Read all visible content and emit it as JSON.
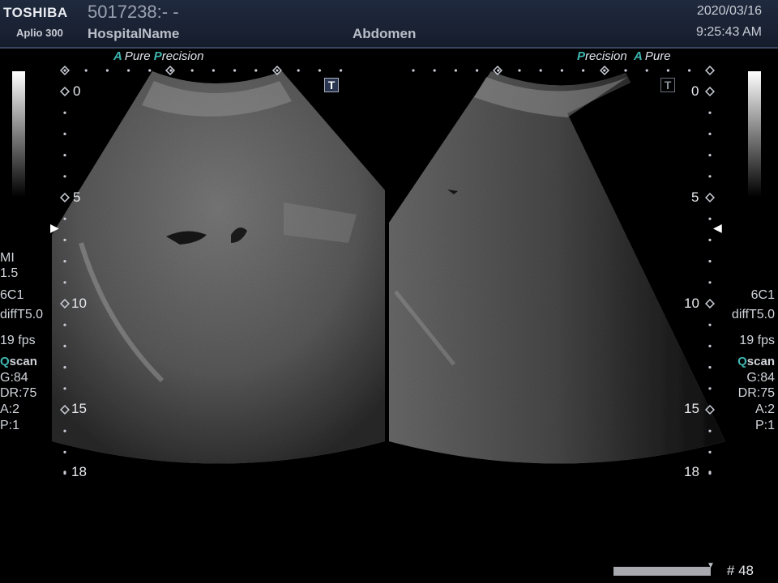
{
  "header": {
    "brand": "TOSHIBA",
    "model": "Aplio 300",
    "patient_id": "5017238:- -",
    "hospital": "HospitalName",
    "exam": "Abdomen",
    "date": "2020/03/16",
    "time": "9:25:43 AM"
  },
  "left_tag": {
    "a": "A",
    "pure": "Pure",
    "p": "P",
    "recision": "recision"
  },
  "right_tag": {
    "p": "P",
    "recision": "recision",
    "a": "A",
    "pure": "Pure"
  },
  "left_params": {
    "mi_label": "MI",
    "mi_value": "1.5",
    "probe": "6C1",
    "mode": "diffT5.0",
    "fps": "19 fps",
    "q": "Q",
    "scan": "scan",
    "gain": "G:84",
    "dr": "DR:75",
    "a": "A:2",
    "p": "P:1"
  },
  "right_params": {
    "probe": "6C1",
    "mode": "diffT5.0",
    "fps": "19 fps",
    "q": "Q",
    "scan": "scan",
    "gain": "G:84",
    "dr": "DR:75",
    "a": "A:2",
    "p": "P:1"
  },
  "depth_marks": [
    "0",
    "5",
    "10",
    "15",
    "18"
  ],
  "t_icon": "T",
  "frame": "# 48",
  "colors": {
    "accent": "#3fb6b0",
    "header_bg": "#1c2436",
    "tissue": "#7a7a7a"
  }
}
